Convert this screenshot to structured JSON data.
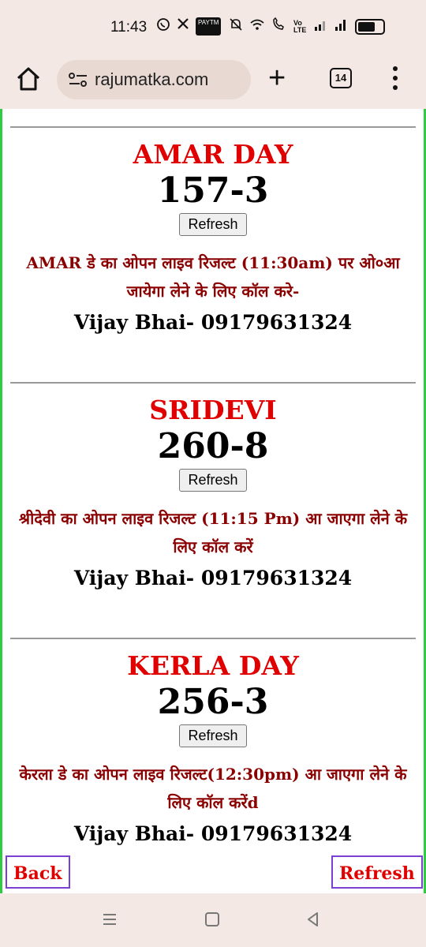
{
  "status_bar": {
    "time": "11:43",
    "left_icons": [
      "whatsapp-icon",
      "x-icon",
      "paytm-icon"
    ],
    "paytm_label": "PAYTM",
    "right_icons": [
      "mute-icon",
      "wifi-icon",
      "wifi-calling-icon",
      "volte-icon",
      "signal-icon",
      "signal-icon",
      "battery-icon"
    ],
    "volte_label": "Vo LTE",
    "battery_level": 0.8
  },
  "browser": {
    "url": "rajumatka.com",
    "tab_count": "14"
  },
  "markets": [
    {
      "name": "AMAR DAY",
      "result": "157-3",
      "refresh_label": "Refresh",
      "note": "AMAR डे का ओपन लाइव रिजल्ट (11:30am) पर ओ०आ जायेगा लेने के लिए कॉल करे-",
      "contact": "Vijay Bhai- 09179631324"
    },
    {
      "name": "SRIDEVI",
      "result": "260-8",
      "refresh_label": "Refresh",
      "note": "श्रीदेवी का ओपन लाइव रिजल्ट (11:15 Pm) आ जाएगा लेने के लिए कॉल करें",
      "contact": "Vijay Bhai- 09179631324"
    },
    {
      "name": "KERLA DAY",
      "result": "256-3",
      "refresh_label": "Refresh",
      "note": "केरला डे का ओपन लाइव रिजल्ट(12:30pm) आ जाएगा लेने के लिए कॉल करेंd",
      "contact": "Vijay Bhai- 09179631324"
    }
  ],
  "floating": {
    "back_label": "Back",
    "refresh_label": "Refresh"
  },
  "colors": {
    "market_name": "#e00000",
    "note": "#8b0000",
    "page_border": "#2ecc40",
    "float_border": "#7b3fd1"
  }
}
